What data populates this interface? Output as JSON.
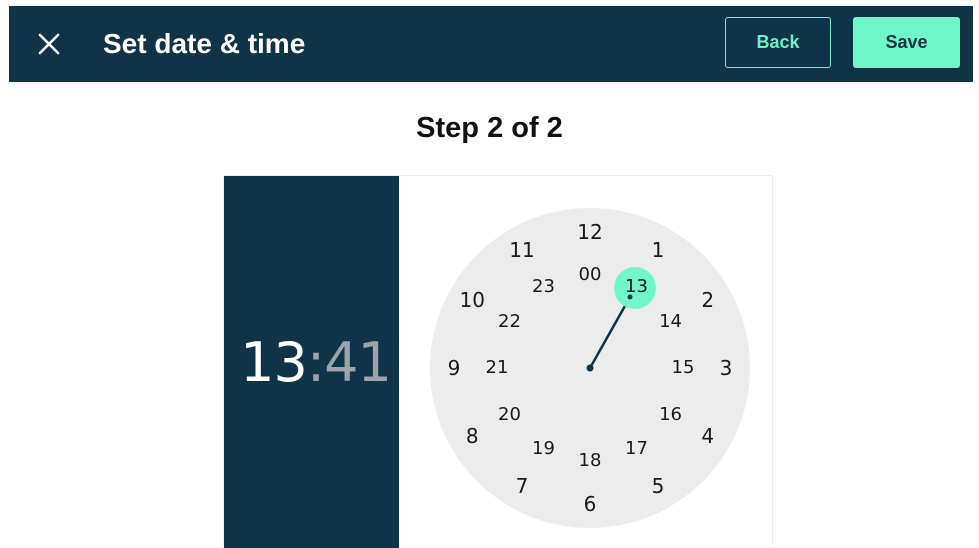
{
  "header": {
    "close_icon": "close-icon",
    "title": "Set date & time",
    "back_label": "Back",
    "save_label": "Save"
  },
  "step_label": "Step 2 of 2",
  "time": {
    "hour": "13",
    "separator": ":",
    "minute": "41"
  },
  "clock": {
    "selected": "13",
    "outer_hours": [
      "12",
      "1",
      "2",
      "3",
      "4",
      "5",
      "6",
      "7",
      "8",
      "9",
      "10",
      "11"
    ],
    "inner_hours": [
      "00",
      "13",
      "14",
      "15",
      "16",
      "17",
      "18",
      "19",
      "20",
      "21",
      "22",
      "23"
    ]
  },
  "colors": {
    "header_bg": "#0f3347",
    "accent": "#6ff7c9",
    "dial_bg": "#ececec",
    "hand": "#0f3347"
  }
}
